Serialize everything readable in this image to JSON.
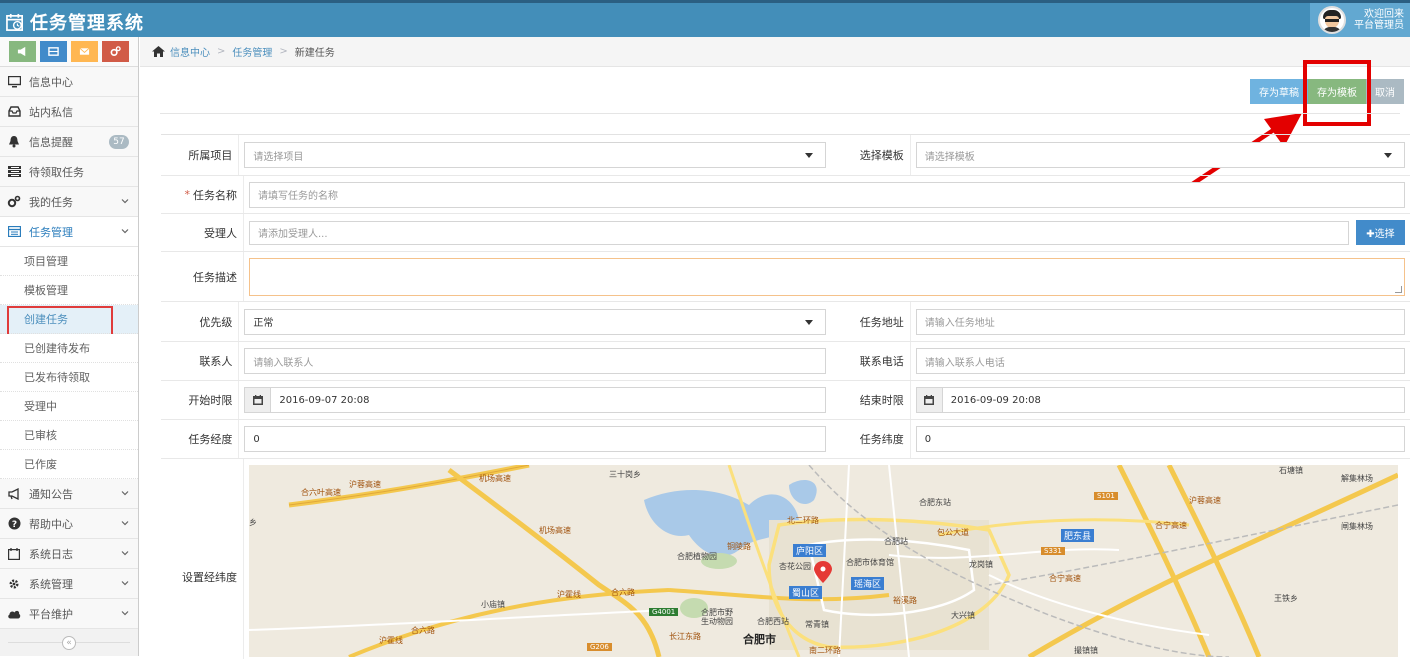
{
  "app": {
    "title": "任务管理系统"
  },
  "user": {
    "greeting": "欢迎回来",
    "name": "平台管理员"
  },
  "sidebar": {
    "items": [
      {
        "label": "信息中心",
        "icon": "desktop-icon"
      },
      {
        "label": "站内私信",
        "icon": "inbox-icon"
      },
      {
        "label": "信息提醒",
        "icon": "bell-icon",
        "badge": "57"
      },
      {
        "label": "待领取任务",
        "icon": "list-icon"
      },
      {
        "label": "我的任务",
        "icon": "cogs-icon"
      },
      {
        "label": "任务管理",
        "icon": "list-alt-icon"
      }
    ],
    "sub_items": [
      "项目管理",
      "模板管理",
      "创建任务",
      "已创建待发布",
      "已发布待领取",
      "受理中",
      "已审核",
      "已作废"
    ],
    "bottom_items": [
      {
        "label": "通知公告",
        "icon": "bullhorn-icon"
      },
      {
        "label": "帮助中心",
        "icon": "question-icon"
      },
      {
        "label": "系统日志",
        "icon": "calendar-icon"
      },
      {
        "label": "系统管理",
        "icon": "gear-icon"
      },
      {
        "label": "平台维护",
        "icon": "cloud-icon"
      }
    ],
    "collapse_glyph": "«"
  },
  "breadcrumb": {
    "home": "信息中心",
    "section": "任务管理",
    "current": "新建任务",
    "separator": ">"
  },
  "toolbar": {
    "draft": "存为草稿",
    "template": "存为模板",
    "cancel": "取消",
    "select": "✚选择"
  },
  "form": {
    "project_label": "所属项目",
    "project_placeholder": "请选择项目",
    "template_label": "选择模板",
    "template_placeholder": "请选择模板",
    "name_label": "任务名称",
    "name_required": "*",
    "name_placeholder": "请填写任务的名称",
    "assignee_label": "受理人",
    "assignee_placeholder": "请添加受理人...",
    "desc_label": "任务描述",
    "priority_label": "优先级",
    "priority_value": "正常",
    "address_label": "任务地址",
    "address_placeholder": "请输入任务地址",
    "contact_label": "联系人",
    "contact_placeholder": "请输入联系人",
    "phone_label": "联系电话",
    "phone_placeholder": "请输入联系人电话",
    "start_label": "开始时限",
    "start_value": "2016-09-07 20:08",
    "end_label": "结束时限",
    "end_value": "2016-09-09 20:08",
    "lng_label": "任务经度",
    "lng_value": "0",
    "lat_label": "任务纬度",
    "lat_value": "0",
    "map_label": "设置经纬度"
  },
  "map": {
    "labels": [
      "三十岗乡",
      "合肥东站",
      "石塘镇",
      "解集林场",
      "闸集林场",
      "王铁乡",
      "撮镇镇",
      "合肥植物园",
      "杏花公园",
      "合肥站",
      "合肥市体育馆",
      "龙岗镇",
      "合肥市野生动物园",
      "合肥西站",
      "常青镇",
      "大兴镇",
      "小庙镇",
      "合肥市",
      "乡"
    ],
    "districts": [
      "庐阳区",
      "瑶海区",
      "蜀山区",
      "肥东县"
    ],
    "roads": [
      "合六叶高速",
      "沪蓉高速",
      "机场高速",
      "机场高速",
      "北二环路",
      "包公大道",
      "合宁高速",
      "沪蓉高速",
      "合宁高速",
      "沪霍线",
      "合六路",
      "合六路",
      "沪霍线",
      "长江东路",
      "南二环路",
      "裕溪路",
      "铜陵路"
    ],
    "codes": [
      "S101",
      "S331",
      "G4001",
      "G206"
    ]
  }
}
